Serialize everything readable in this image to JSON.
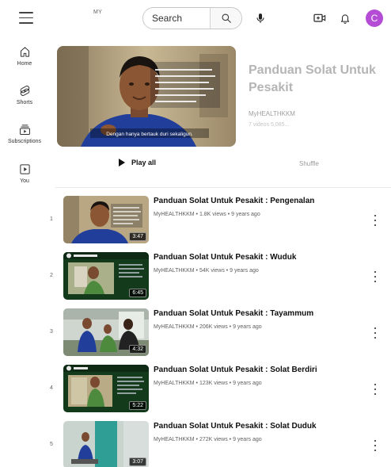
{
  "header": {
    "logo_text": "MY",
    "search_placeholder": "Search",
    "avatar_letter": "C",
    "icons": [
      "menu-icon",
      "search-icon",
      "mic-icon",
      "create-icon",
      "bell-icon"
    ],
    "avatar_color": "#b44cd6"
  },
  "sidebar": {
    "items": [
      {
        "label": "Home",
        "icon": "home-icon"
      },
      {
        "label": "Shorts",
        "icon": "shorts-icon"
      },
      {
        "label": "Subscriptions",
        "icon": "subscriptions-icon"
      },
      {
        "label": "You",
        "icon": "you-icon"
      }
    ]
  },
  "playlist": {
    "title": "Panduan Solat Untuk Pesakit",
    "channel": "MyHEALTHKKM",
    "meta": "7 videos  5,085...",
    "hero_subtitle": "Dengan hanya bertauk duri sekaligun.",
    "play_all_label": "Play all",
    "shuffle_label": "Shuffle"
  },
  "videos": [
    {
      "index": "1",
      "title": "Panduan Solat Untuk Pesakit : Pengenalan",
      "meta": "MyHEALTHKKM • 1.8K views • 9 years ago",
      "duration": "3:47"
    },
    {
      "index": "2",
      "title": "Panduan Solat Untuk Pesakit : Wuduk",
      "meta": "MyHEALTHKKM • 54K views • 9 years ago",
      "duration": "6:45"
    },
    {
      "index": "3",
      "title": "Panduan Solat Untuk Pesakit : Tayammum",
      "meta": "MyHEALTHKKM • 206K views • 9 years ago",
      "duration": "4:32"
    },
    {
      "index": "4",
      "title": "Panduan Solat Untuk Pesakit : Solat Berdiri",
      "meta": "MyHEALTHKKM • 123K views • 9 years ago",
      "duration": "5:22"
    },
    {
      "index": "5",
      "title": "Panduan Solat Untuk Pesakit : Solat Duduk",
      "meta": "MyHEALTHKKM • 272K views • 9 years ago",
      "duration": "3:07"
    }
  ]
}
